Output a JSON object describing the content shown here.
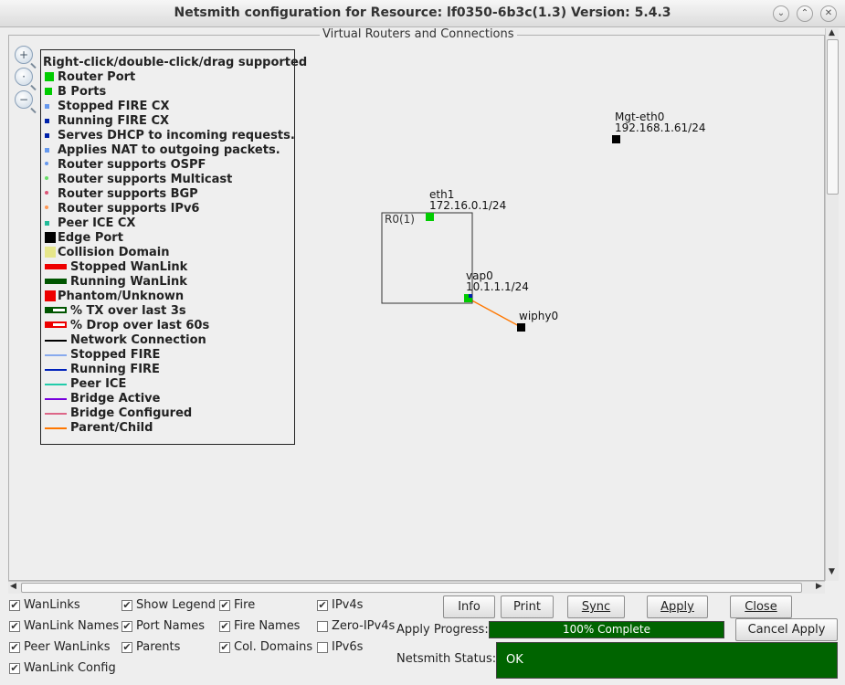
{
  "window": {
    "title": "Netsmith configuration for Resource:  lf0350-6b3c(1.3)  Version: 5.4.3",
    "controls": [
      "⌄",
      "⌃",
      "✕"
    ]
  },
  "canvas": {
    "frame_title": "Virtual Routers and Connections"
  },
  "zoom": [
    "+",
    "·",
    "−"
  ],
  "legend": {
    "header": "Right-click/double-click/drag supported",
    "items": [
      {
        "label": "Router Port",
        "color": "#00cc00"
      },
      {
        "label": "B Ports",
        "color": "#00cc00"
      },
      {
        "label": "Stopped FIRE CX",
        "color": "#6699ee"
      },
      {
        "label": "Running FIRE CX",
        "color": "#0022aa"
      },
      {
        "label": "Serves DHCP to incoming requests.",
        "color": "#0022aa"
      },
      {
        "label": "Applies NAT to outgoing packets.",
        "color": "#6699ee"
      },
      {
        "label": "Router supports OSPF",
        "color": "#6699ee"
      },
      {
        "label": "Router supports Multicast",
        "color": "#66dd66"
      },
      {
        "label": "Router supports BGP",
        "color": "#dd5577"
      },
      {
        "label": "Router supports IPv6",
        "color": "#ff9955"
      },
      {
        "label": "Peer ICE CX",
        "color": "#22bb99"
      },
      {
        "label": "Edge Port",
        "color": "#000000"
      },
      {
        "label": "Collision Domain",
        "color": "#e6e68a"
      },
      {
        "label": "Stopped WanLink",
        "color": "#ee0000"
      },
      {
        "label": "Running WanLink",
        "color": "#005500"
      },
      {
        "label": "Phantom/Unknown",
        "color": "#ee0000"
      },
      {
        "label": "% TX over last 3s",
        "color": "#005500"
      },
      {
        "label": "% Drop over last 60s",
        "color": "#ee0000"
      },
      {
        "label": "Network Connection",
        "color": "#000000"
      },
      {
        "label": "Stopped FIRE",
        "color": "#88aaee"
      },
      {
        "label": "Running FIRE",
        "color": "#0022bb"
      },
      {
        "label": "Peer ICE",
        "color": "#22ccaa"
      },
      {
        "label": "Bridge Active",
        "color": "#7700dd"
      },
      {
        "label": "Bridge Configured",
        "color": "#dd6688"
      },
      {
        "label": "Parent/Child",
        "color": "#ff7700"
      }
    ]
  },
  "topology": {
    "router": {
      "label": "R0(1)"
    },
    "ports": [
      {
        "name": "eth1",
        "ip": "172.16.0.1/24",
        "color": "#00cc00"
      },
      {
        "name": "vap0",
        "ip": "10.1.1.1/24",
        "color": "#00cc00"
      },
      {
        "name": "wiphy0",
        "ip": "",
        "color": "#000000"
      },
      {
        "name": "Mgt-eth0",
        "ip": "192.168.1.61/24",
        "color": "#000000"
      }
    ],
    "link_color": "#ff7700"
  },
  "options": {
    "col1": [
      {
        "label": "WanLinks",
        "checked": true
      },
      {
        "label": "WanLink Names",
        "checked": true
      },
      {
        "label": "Peer WanLinks",
        "checked": true
      },
      {
        "label": "WanLink Config",
        "checked": true
      }
    ],
    "col2": [
      {
        "label": "Show Legend",
        "checked": true
      },
      {
        "label": "Port Names",
        "checked": true
      },
      {
        "label": "Parents",
        "checked": true
      }
    ],
    "col3": [
      {
        "label": "Fire",
        "checked": true
      },
      {
        "label": "Fire Names",
        "checked": true
      },
      {
        "label": "Col. Domains",
        "checked": true
      }
    ],
    "col4": [
      {
        "label": "IPv4s",
        "checked": true
      },
      {
        "label": "Zero-IPv4s",
        "checked": false
      },
      {
        "label": "IPv6s",
        "checked": false
      }
    ]
  },
  "buttons": {
    "info": "Info",
    "print": "Print",
    "sync": "Sync",
    "apply": "Apply",
    "close": "Close",
    "cancel_apply": "Cancel Apply"
  },
  "apply_progress": {
    "label": "Apply Progress:",
    "text": "100% Complete",
    "value": 1.0
  },
  "netsmith_status": {
    "label": "Netsmith Status:",
    "text": "OK"
  }
}
